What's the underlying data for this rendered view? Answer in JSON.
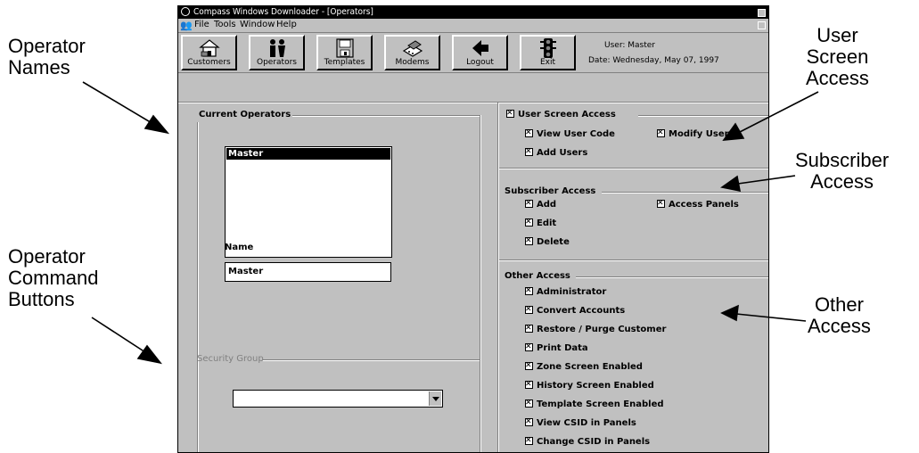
{
  "callouts": {
    "operator_names": [
      "Operator",
      "Names"
    ],
    "operator_command_buttons": [
      "Operator",
      "Command",
      "Buttons"
    ],
    "user_screen_access": [
      "User",
      "Screen",
      "Access"
    ],
    "subscriber_access": [
      "Subscriber",
      "Access"
    ],
    "other_access": [
      "Other",
      "Access"
    ]
  },
  "window": {
    "title": "Compass Windows Downloader - [Operators]"
  },
  "menu": {
    "file": "File",
    "tools": "Tools",
    "window": "Window",
    "help": "Help"
  },
  "toolbar": {
    "customers": "Customers",
    "operators": "Operators",
    "templates": "Templates",
    "modems": "Modems",
    "logout": "Logout",
    "exit": "Exit"
  },
  "user_info": {
    "user": "User: Master",
    "date": "Date: Wednesday, May 07, 1997"
  },
  "current_operators": {
    "group_label": "Current Operators",
    "operators": [
      "Master"
    ],
    "name_label": "Name",
    "name_value": "Master"
  },
  "security_group": {
    "group_label": "Security Group",
    "selected": ""
  },
  "user_screen_access": {
    "label": "User Screen Access",
    "checked": true,
    "items": [
      "View User Code",
      "Add Users",
      "Modify Users"
    ]
  },
  "subscriber_access": {
    "label": "Subscriber Access",
    "items": [
      "Add",
      "Edit",
      "Delete",
      "Access Panels"
    ]
  },
  "other_access": {
    "label": "Other Access",
    "items": [
      "Administrator",
      "Convert Accounts",
      "Restore / Purge Customer",
      "Print Data",
      "Zone Screen Enabled",
      "History Screen Enabled",
      "Template Screen Enabled",
      "View CSID in Panels",
      "Change CSID in Panels"
    ]
  },
  "colors": {
    "window_bg": "#c0c0c0",
    "titlebar": "#000000",
    "selection": "#000000"
  }
}
